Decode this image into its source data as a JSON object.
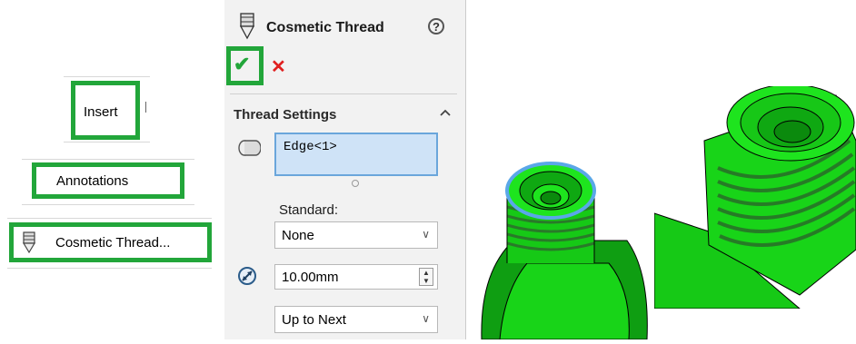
{
  "menu": {
    "insert_label": "Insert",
    "annotations_label": "Annotations",
    "cosmetic_thread_label": "Cosmetic Thread..."
  },
  "property_manager": {
    "title": "Cosmetic Thread",
    "help_glyph": "?",
    "ok_glyph": "✔",
    "cancel_glyph": "✕",
    "section_title": "Thread Settings",
    "edge_value": "Edge<1>",
    "standard_label": "Standard:",
    "standard_value": "None",
    "depth_value": "10.00mm",
    "end_condition_value": "Up to Next"
  },
  "colors": {
    "highlight": "#22a63a",
    "model_green": "#18e018",
    "selection_blue": "#6aa6db"
  },
  "icons": [
    "cosmetic-thread-icon",
    "help-icon",
    "ok-check-icon",
    "cancel-x-icon",
    "collapse-chevron-icon",
    "edge-selection-icon",
    "depth-icon",
    "dropdown-arrow-icon"
  ]
}
